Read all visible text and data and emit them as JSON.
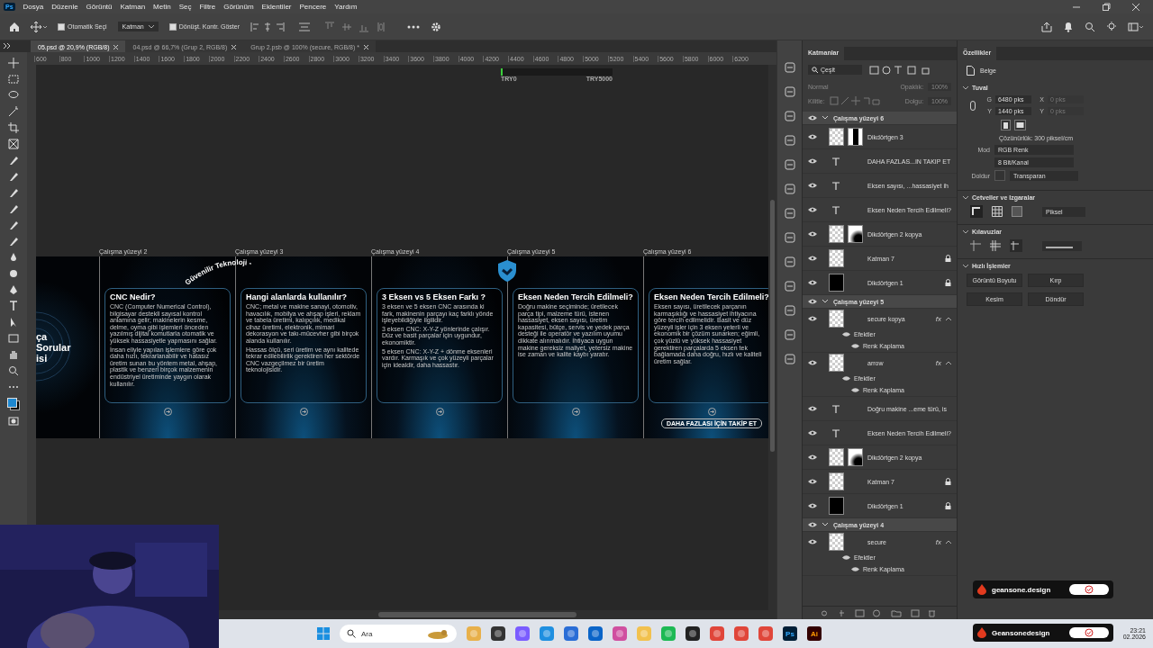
{
  "app_badge": "Ps",
  "menu": [
    "Dosya",
    "Düzenle",
    "Görüntü",
    "Katman",
    "Metin",
    "Seç",
    "Filtre",
    "Görünüm",
    "Eklentiler",
    "Pencere",
    "Yardım"
  ],
  "options": {
    "auto_select": {
      "label": "Otomatik Seçi",
      "checked": true
    },
    "target": "Katman",
    "transform": {
      "label": "Dönüşt. Kontr. Göster",
      "checked": true
    }
  },
  "tabs": [
    {
      "label": "05.psd @ 20,9% (RGB/8)",
      "selected": true
    },
    {
      "label": "04.psd @ 66,7% (Grup 2, RGB/8)",
      "selected": false
    },
    {
      "label": "Grup 2.psb @ 100% (secure, RGB/8) *",
      "selected": false
    }
  ],
  "ruler": [
    "600",
    "800",
    "1000",
    "1200",
    "1400",
    "1600",
    "1800",
    "2000",
    "2200",
    "2400",
    "2600",
    "2800",
    "3000",
    "3200",
    "3400",
    "3600",
    "3800",
    "4000",
    "4200",
    "4400",
    "4600",
    "4800",
    "5000",
    "5200",
    "5400",
    "5600",
    "5800",
    "6000",
    "6200"
  ],
  "price_bar": {
    "min": "TRY0",
    "max": "TRY5000",
    "level": 0.02
  },
  "artboards": [
    {
      "kind": "partial",
      "lines": [
        "ça",
        "Sorular",
        "isi"
      ]
    },
    {
      "kind": "card",
      "label": "Çalışma yüzeyi 2",
      "title": "CNC Nedir?",
      "body": [
        "CNC (Computer Numerical Control), bilgisayar destekli sayısal kontrol anlamına gelir; makinelerin kesme, delme, oyma gibi işlemleri önceden yazılmış dijital komutlarla otomatik ve yüksek hassasiyetle yapmasını sağlar.",
        "İnsan eliyle yapılan işlemlere göre çok daha hızlı, tekrarlanabilir ve hatasız üretim sunan bu yöntem metal, ahşap, plastik ve benzeri birçok malzemenin endüstriyel üretiminde yaygın olarak kullanılır."
      ]
    },
    {
      "kind": "card",
      "label": "Çalışma yüzeyi 3",
      "title": "Hangi alanlarda kullanılır?",
      "arc_text": "Güvenilir Teknoloji -",
      "body": [
        "CNC; metal ve makine sanayi, otomotiv, havacılık, mobilya ve ahşap işleri, reklam ve tabela üretimi, kalıpçılık, medikal cihaz üretimi, elektronik, mimari dekorasyon ve takı-mücevher gibi birçok alanda kullanılır.",
        "Hassas ölçü, seri üretim ve aynı kalitede tekrar edilebilirlik gerektiren her sektörde CNC vazgeçilmez bir üretim teknolojisidir."
      ]
    },
    {
      "kind": "card",
      "label": "Çalışma yüzeyi 4",
      "title": "3 Eksen vs 5 Eksen Farkı ?",
      "body": [
        "3 eksen ve 5 eksen CNC arasında ki fark, makinenin parçayı kaç farklı yönde işleyebildiğiyle ilgilidir.",
        "3 eksen CNC: X-Y-Z yönlerinde çalışır. Düz ve basit parçalar için uygundur, ekonomiktir.",
        "5 eksen CNC: X-Y-Z + dönme eksenleri vardır. Karmaşık ve çok yüzeyli parçalar için idealdir, daha hassastır."
      ]
    },
    {
      "kind": "shieldcard",
      "label": "Çalışma yüzeyi 5",
      "title": "Eksen Neden Tercih Edilmeli?",
      "body": [
        "Doğru makine seçiminde; üretilecek parça tipi, malzeme türü, istenen hassasiyet, eksen sayısı, üretim kapasitesi, bütçe, servis ve yedek parça desteği ile operatör ve yazılım uyumu dikkate alınmalıdır. İhtiyaca uygun makine gereksiz maliyet, yetersiz makine ise zaman ve kalite kaybı yaratır."
      ]
    },
    {
      "kind": "card",
      "label": "Çalışma yüzeyi 6",
      "title": "Eksen Neden Tercih Edilmeli?",
      "button": "DAHA FAZLASI İÇİN TAKİP ET",
      "body": [
        "Eksen sayısı, üretilecek parçanın karmaşıklığı ve hassasiyet ihtiyacına göre tercih edilmelidir. Basit ve düz yüzeyli işler için 3 eksen yeterli ve ekonomik bir çözüm sunarken; eğimli, çok yüzlü ve yüksek hassasiyet gerektiren parçalarda 5 eksen tek bağlamada daha doğru, hızlı ve kaliteli üretim sağlar."
      ]
    }
  ],
  "layers": {
    "title": "Katmanlar",
    "filter": "Çeşit",
    "blend": "Normal",
    "opacity_label": "Opaklık:",
    "opacity": "100%",
    "lock_label": "Kilitle:",
    "fill_label": "Dolgu:",
    "fill": "100%",
    "groups": [
      {
        "name": "Çalışma yüzeyi 6",
        "visible": true,
        "expanded": true,
        "children": [
          {
            "kind": "banded",
            "name": "Dikdörtgen 3",
            "locked": false,
            "visible": true
          },
          {
            "kind": "text",
            "name": "DAHA FAZLAS...IN TAKIP ET",
            "locked": false,
            "visible": true
          },
          {
            "kind": "text",
            "name": "Eksen sayısı, ...hassasiyet ih",
            "locked": false,
            "visible": true
          },
          {
            "kind": "text",
            "name": "Eksen Neden Tercih Edilmeli?",
            "locked": false,
            "visible": true
          },
          {
            "kind": "faded",
            "name": "Dikdörtgen 2 kopya",
            "locked": false,
            "visible": true
          },
          {
            "kind": "pixel",
            "name": "Katman 7",
            "locked": true,
            "visible": true
          },
          {
            "kind": "solid",
            "name": "Dikdörtgen 1",
            "locked": true,
            "visible": true
          }
        ]
      },
      {
        "name": "Çalışma yüzeyi 5",
        "visible": true,
        "expanded": true,
        "children": [
          {
            "kind": "pixel",
            "name": "secure kopya",
            "locked": false,
            "visible": true,
            "fx": "fx",
            "expanded": true,
            "children": [
              {
                "name": "Efektler",
                "visible": true,
                "children": [
                  {
                    "name": "Renk Kaplama",
                    "visible": true
                  }
                ]
              }
            ]
          },
          {
            "kind": "pixel",
            "name": "arrow",
            "locked": false,
            "visible": true,
            "fx": "fx",
            "expanded": true,
            "children": [
              {
                "name": "Efektler",
                "visible": true,
                "children": [
                  {
                    "name": "Renk Kaplama",
                    "visible": true
                  }
                ]
              }
            ]
          },
          {
            "kind": "text",
            "name": "Doğru makine ...eme türü, is",
            "locked": false,
            "visible": true
          },
          {
            "kind": "text",
            "name": "Eksen Neden Tercih Edilmeli?",
            "locked": false,
            "visible": true
          },
          {
            "kind": "faded",
            "name": "Dikdörtgen 2 kopya",
            "locked": false,
            "visible": true
          },
          {
            "kind": "pixel",
            "name": "Katman 7",
            "locked": true,
            "visible": true
          },
          {
            "kind": "solid",
            "name": "Dikdörtgen 1",
            "locked": true,
            "visible": true
          }
        ]
      },
      {
        "name": "Çalışma yüzeyi 4",
        "visible": true,
        "expanded": true,
        "children": [
          {
            "kind": "pixel",
            "name": "secure",
            "locked": false,
            "visible": true,
            "fx": "fx",
            "expanded": true,
            "children": [
              {
                "name": "Efektler",
                "visible": true,
                "children": [
                  {
                    "name": "Renk Kaplama",
                    "visible": true
                  }
                ]
              }
            ]
          }
        ]
      }
    ]
  },
  "properties": {
    "title": "Özellikler",
    "doc": "Belge",
    "canvas": {
      "title": "Tuval",
      "w_label": "G",
      "w": "6480 pks",
      "x_label": "X",
      "x": "0 pks",
      "h_label": "Y",
      "h": "1440 pks",
      "y_label": "Y",
      "y": "0 pks",
      "resolution": "Çözünürlük: 300 piksel/cm",
      "mode_label": "Mod",
      "mode": "RGB Renk",
      "depth": "8 Bit/Kanal",
      "fill_label": "Doldur",
      "fill": "Transparan"
    },
    "rulers": {
      "title": "Cetveller ve Izgaralar",
      "unit": "Piksel"
    },
    "guides": {
      "title": "Kılavuzlar"
    },
    "quick": {
      "title": "Hızlı İşlemler",
      "buttons": [
        "Görüntü Boyutu",
        "Kırp",
        "Kesim",
        "Döndür"
      ]
    }
  },
  "overlay_badges": [
    "geansone.design",
    "Geansonedesign"
  ],
  "taskbar": {
    "search": "Ara",
    "labeled_apps": [
      "Ps",
      "Ai"
    ],
    "time": "23:21",
    "date": "02.2026"
  }
}
